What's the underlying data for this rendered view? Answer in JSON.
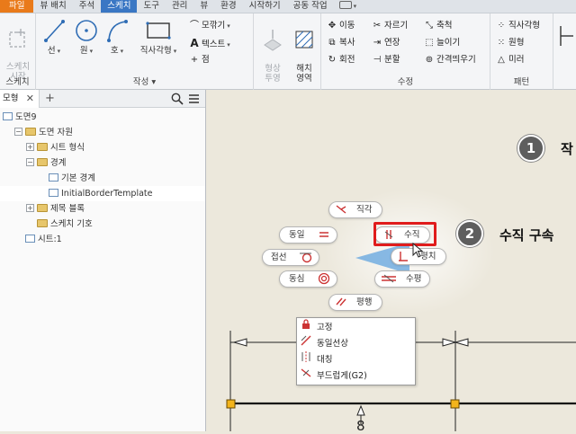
{
  "tabs": [
    {
      "label": "파일",
      "kind": "file"
    },
    {
      "label": "뷰 배치",
      "kind": ""
    },
    {
      "label": "주석",
      "kind": ""
    },
    {
      "label": "스케치",
      "kind": "active"
    },
    {
      "label": "도구",
      "kind": ""
    },
    {
      "label": "관리",
      "kind": ""
    },
    {
      "label": "뷰",
      "kind": ""
    },
    {
      "label": "환경",
      "kind": ""
    },
    {
      "label": "시작하기",
      "kind": ""
    },
    {
      "label": "공동 작업",
      "kind": ""
    }
  ],
  "ribbon": {
    "sketch_panel": {
      "title": "스케치",
      "start_label": "스케치\n시작"
    },
    "create_panel": {
      "title": "작성 ▾",
      "line": "선",
      "circle": "원",
      "arc": "호",
      "rectangle": "직사각형",
      "fillet": "모깎기",
      "text": "텍스트",
      "point": "점"
    },
    "format_panel": {
      "shape_label": "형상\n투영",
      "hatch_label": "해치\n영역"
    },
    "modify_panel": {
      "title": "수정",
      "move": "이동",
      "trim": "자르기",
      "scale": "축척",
      "copy": "복사",
      "extend": "연장",
      "stretch": "늘이기",
      "rotate": "회전",
      "split": "분할",
      "offset": "간격띄우기"
    },
    "pattern_panel": {
      "title": "패턴",
      "rect_pattern": "직사각형",
      "circ_pattern": "원형",
      "mirror": "미러"
    }
  },
  "browser": {
    "tab_label": "모형",
    "nodes": [
      {
        "label": "도면9",
        "indent": 0,
        "expander": "",
        "icon": "drawing"
      },
      {
        "label": "도면 자원",
        "indent": 1,
        "expander": "−",
        "icon": "folder"
      },
      {
        "label": "시트 형식",
        "indent": 2,
        "expander": "+",
        "icon": "folder"
      },
      {
        "label": "경계",
        "indent": 2,
        "expander": "−",
        "icon": "folder"
      },
      {
        "label": "기본 경계",
        "indent": 3,
        "expander": "",
        "icon": "sheet"
      },
      {
        "label": "InitialBorderTemplate",
        "indent": 3,
        "expander": "",
        "icon": "sheet",
        "selected": true
      },
      {
        "label": "제목 블록",
        "indent": 2,
        "expander": "+",
        "icon": "folder"
      },
      {
        "label": "스케치 기호",
        "indent": 2,
        "expander": "",
        "icon": "folder"
      },
      {
        "label": "시트:1",
        "indent": 1,
        "expander": "",
        "icon": "sheet"
      }
    ]
  },
  "marking_menu": {
    "perpendicular": "직각",
    "coincident": "동일",
    "vertical": "수직",
    "tangent": "접선",
    "horizontal_partial": "평치",
    "concentric": "동심",
    "horizontal": "수평",
    "parallel": "평행"
  },
  "constraint_menu": {
    "items": [
      "고정",
      "동일선상",
      "대칭",
      "부드럽게(G2)"
    ]
  },
  "steps": [
    {
      "num": "1",
      "text": "작"
    },
    {
      "num": "2",
      "text": "수직 구속 "
    }
  ],
  "dimension_text": "8",
  "colors": {
    "accent": "#3a77c4",
    "file_tab": "#e97a1a",
    "highlight": "#e01c1c"
  }
}
